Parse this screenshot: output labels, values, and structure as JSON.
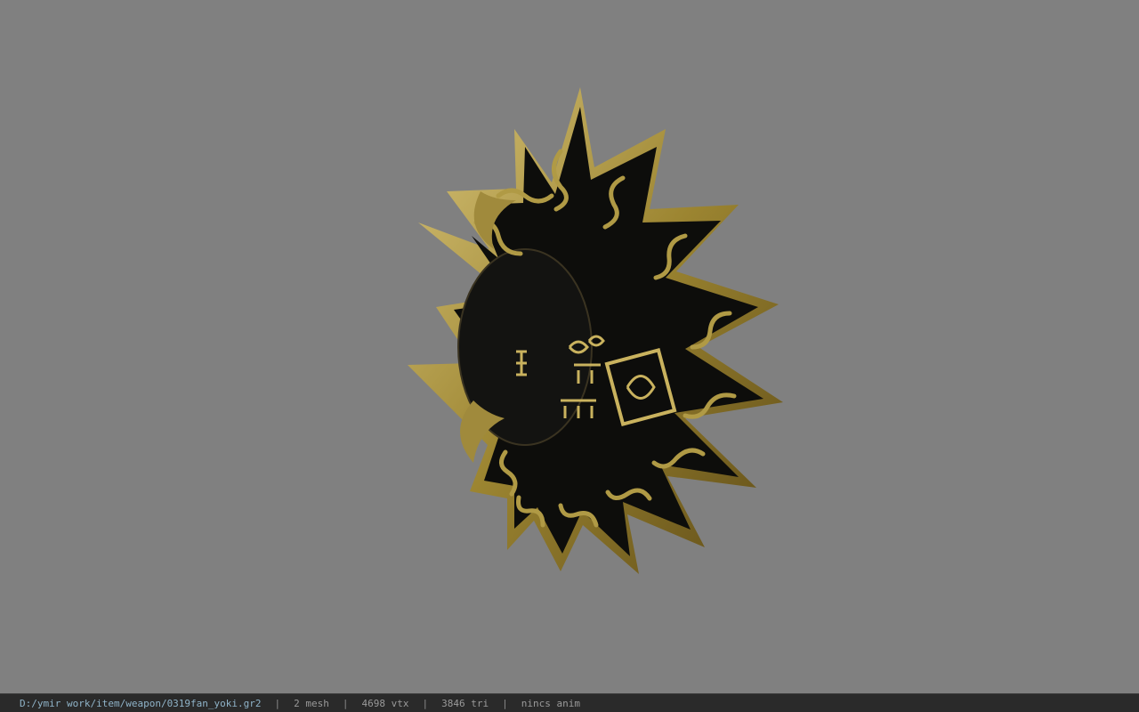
{
  "viewer": {
    "background_color": "#808080",
    "model_icon": "sun-fan-weapon-model"
  },
  "statusbar": {
    "file_path": "D:/ymir work/item/weapon/0319fan_yoki.gr2",
    "separator": "|",
    "mesh_count": "2 mesh",
    "vertex_count": "4698 vtx",
    "triangle_count": "3846 tri",
    "anim_status": "nincs anim"
  }
}
